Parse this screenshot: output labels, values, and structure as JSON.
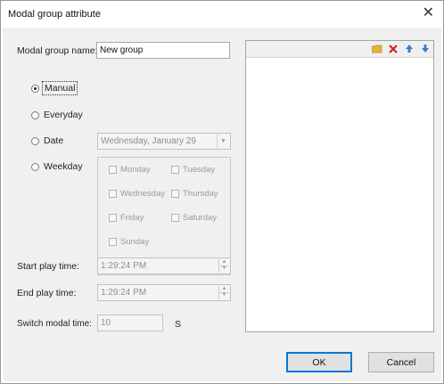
{
  "window": {
    "title": "Modal group attribute",
    "close_glyph": "✕"
  },
  "form": {
    "name_label": "Modal group name:",
    "name_value": "New group",
    "schedule": {
      "selected": "manual",
      "options": [
        {
          "id": "manual",
          "label": "Manual"
        },
        {
          "id": "everyday",
          "label": "Everyday"
        },
        {
          "id": "date",
          "label": "Date"
        },
        {
          "id": "weekday",
          "label": "Weekday"
        }
      ]
    },
    "date_value": "Wednesday,  January  29",
    "weekdays": [
      "Monday",
      "Tuesday",
      "Wednesday",
      "Thursday",
      "Friday",
      "Saturday",
      "Sunday"
    ],
    "start_label": "Start play time:",
    "start_value": "1:29:24 PM",
    "end_label": "End play time:",
    "end_value": "1:29:24 PM",
    "switch_label": "Switch modal time:",
    "switch_value": "10",
    "switch_unit": "S"
  },
  "panel": {
    "toolbar_icons": [
      "folder-icon",
      "delete-icon",
      "arrow-up-icon",
      "arrow-down-icon"
    ]
  },
  "buttons": {
    "ok": "OK",
    "cancel": "Cancel"
  },
  "colors": {
    "accent": "#0078d7",
    "delete_red": "#d42020",
    "folder_yellow": "#e8b33a",
    "arrow_blue": "#3a7bd5"
  }
}
